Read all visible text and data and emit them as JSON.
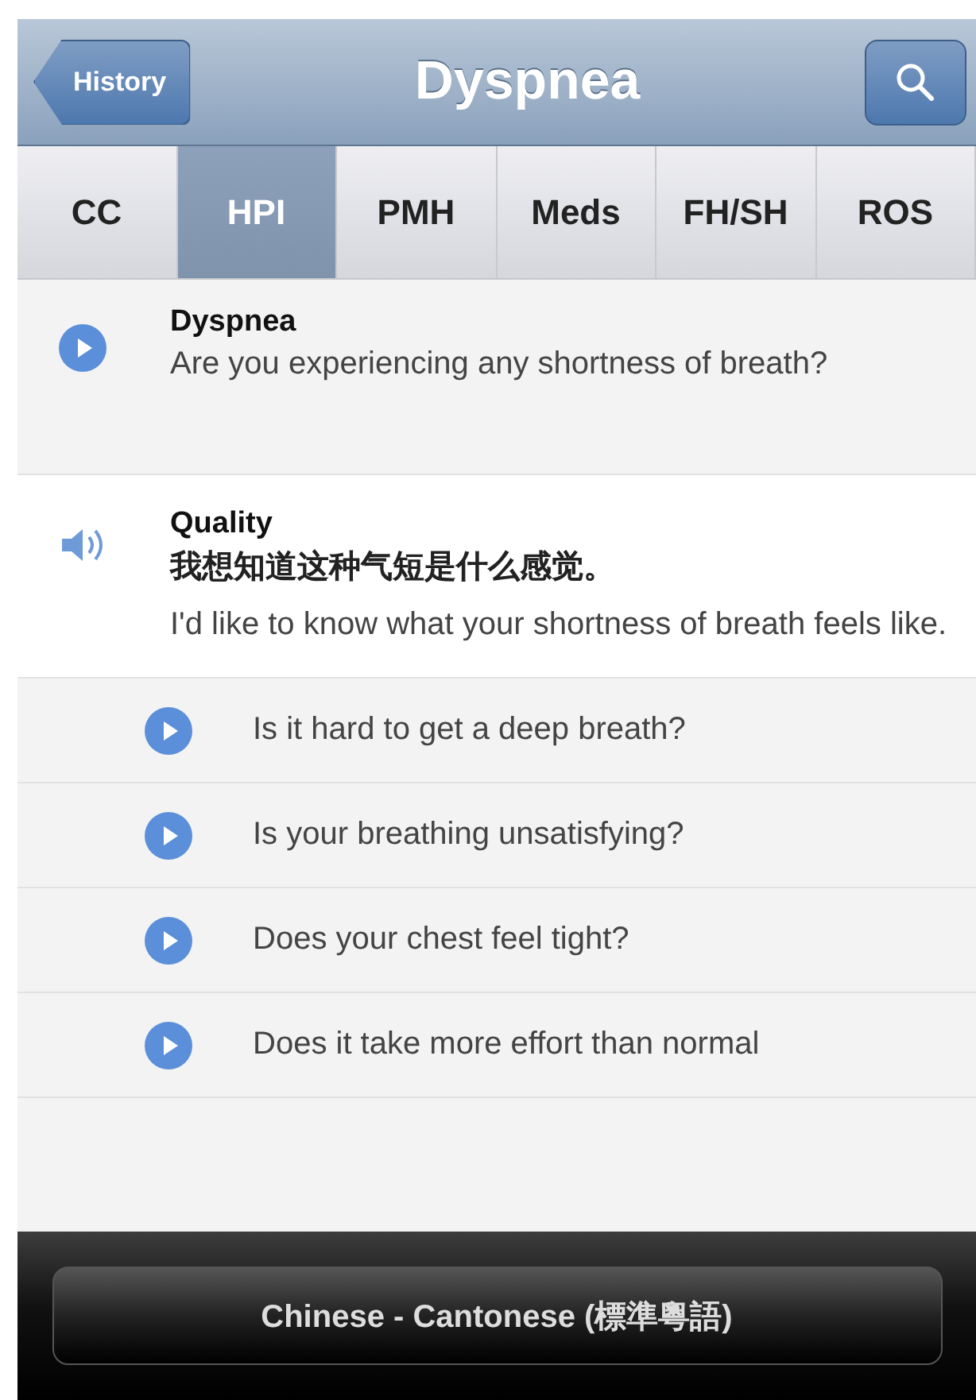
{
  "nav_bar": {
    "back_button": "History",
    "title": "Dyspnea"
  },
  "tabs": [
    {
      "label": "CC",
      "selected": false
    },
    {
      "label": "HPI",
      "selected": true
    },
    {
      "label": "PMH",
      "selected": false
    },
    {
      "label": "Meds",
      "selected": false
    },
    {
      "label": "FH/SH",
      "selected": false
    },
    {
      "label": "ROS",
      "selected": false
    }
  ],
  "items": [
    {
      "kind": "play",
      "title": "Dyspnea",
      "text": "Are you experiencing any shortness of breath?"
    },
    {
      "kind": "speaker",
      "title": "Quality",
      "translation": "我想知道这种气短是什么感觉。",
      "text": "I'd like to know what your shortness of breath feels like."
    },
    {
      "kind": "sub",
      "text": "Is it hard to get a deep breath?"
    },
    {
      "kind": "sub",
      "text": "Is your breathing unsatisfying?"
    },
    {
      "kind": "sub",
      "text": "Does your chest feel tight?"
    },
    {
      "kind": "sub",
      "text": "Does it take more effort than normal"
    }
  ],
  "language_bar": {
    "label": "Chinese - Cantonese (標準粵語)"
  }
}
